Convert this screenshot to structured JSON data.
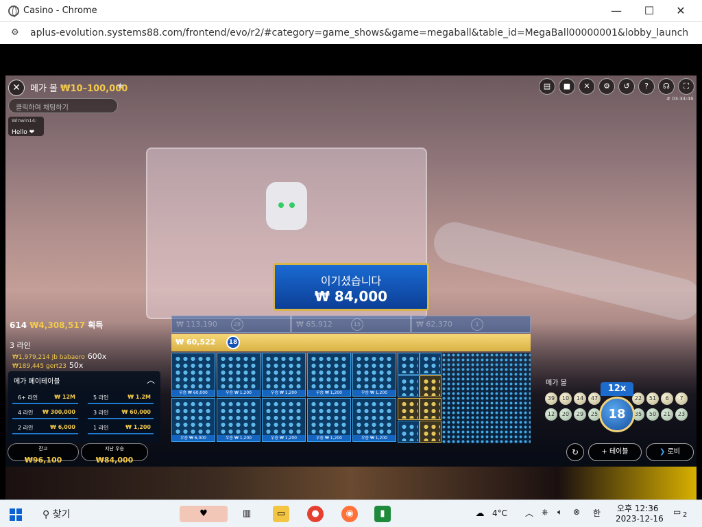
{
  "window": {
    "title": "Casino - Chrome",
    "minimize": "—",
    "maximize": "☐",
    "close": "✕"
  },
  "address_bar": {
    "url": "aplus-evolution.systems88.com/frontend/evo/r2/#category=game_shows&game=megaball&table_id=MegaBall00000001&lobby_launch_id=e792ee..."
  },
  "game_header": {
    "close": "✕",
    "title": "메가 볼",
    "limits": "₩10–100,000",
    "chat_placeholder": "클릭하여 채팅하기",
    "chat_user": "Winwin14:",
    "chat_message": "Hello ❤",
    "timestamp": "# 03:34:46"
  },
  "top_icons": [
    "chat-icon",
    "video-icon",
    "mute-icon",
    "settings-icon",
    "history-icon",
    "help-icon",
    "support-icon",
    "fullscreen-icon"
  ],
  "win_banner": {
    "line1": "이기셨습니다",
    "line2": "₩ 84,000"
  },
  "winners": {
    "count": "614",
    "amount": "₩4,308,517",
    "suffix": "획득",
    "lines_title": "3 라인",
    "rows": [
      {
        "amount": "₩1,979,214 Jb babaero",
        "mult": "600x"
      },
      {
        "amount": "₩189,445 gert23",
        "mult": "50x"
      }
    ]
  },
  "paytable": {
    "title": "메가 페이테이블",
    "rows": [
      {
        "label": "6+ 라인",
        "value": "₩ 12M"
      },
      {
        "label": "5 라인",
        "value": "₩ 1.2M"
      },
      {
        "label": "4 라인",
        "value": "₩ 300,000"
      },
      {
        "label": "3 라인",
        "value": "₩ 60,000"
      },
      {
        "label": "2 라인",
        "value": "₩ 6,000"
      },
      {
        "label": "1 라인",
        "value": "₩ 1,200"
      }
    ]
  },
  "balance": {
    "label": "잔고",
    "value": "₩96,100"
  },
  "last_win": {
    "label": "지난 우승",
    "value": "₩84,000"
  },
  "card_strip": [
    {
      "amount": "₩ 113,190",
      "ball": "28"
    },
    {
      "amount": "₩ 65,912",
      "ball": "15"
    },
    {
      "amount": "₩ 62,370",
      "ball": "1"
    }
  ],
  "featured_card": {
    "amount": "₩ 60,522",
    "ball": "18"
  },
  "cards": [
    {
      "label": "우승 ₩ 60,000"
    },
    {
      "label": "우승 ₩ 1,200"
    },
    {
      "label": "우승 ₩ 1,200"
    },
    {
      "label": "우승 ₩ 1,200"
    },
    {
      "label": "우승 ₩ 1,200"
    },
    {
      "label": "우승 ₩ 6,000"
    },
    {
      "label": "우승 ₩ 1,200"
    },
    {
      "label": "우승 ₩ 1,200"
    },
    {
      "label": "우승 ₩ 1,200"
    },
    {
      "label": "우승 ₩ 1,200"
    }
  ],
  "mega_balls": {
    "title": "메가 볼",
    "row1": [
      "39",
      "10",
      "14",
      "47",
      "22",
      "51",
      "6",
      "7"
    ],
    "row2": [
      "12",
      "20",
      "29",
      "25",
      "35",
      "50",
      "21",
      "23"
    ],
    "mega_number": "18",
    "multiplier": "12x"
  },
  "actions": {
    "repeat": "↻",
    "table": "테이블",
    "lobby": "로비"
  },
  "taskbar": {
    "search": "찾기",
    "weather": "4°C",
    "ime": "한",
    "time": "오후 12:36",
    "date": "2023-12-16",
    "notif": "2"
  }
}
